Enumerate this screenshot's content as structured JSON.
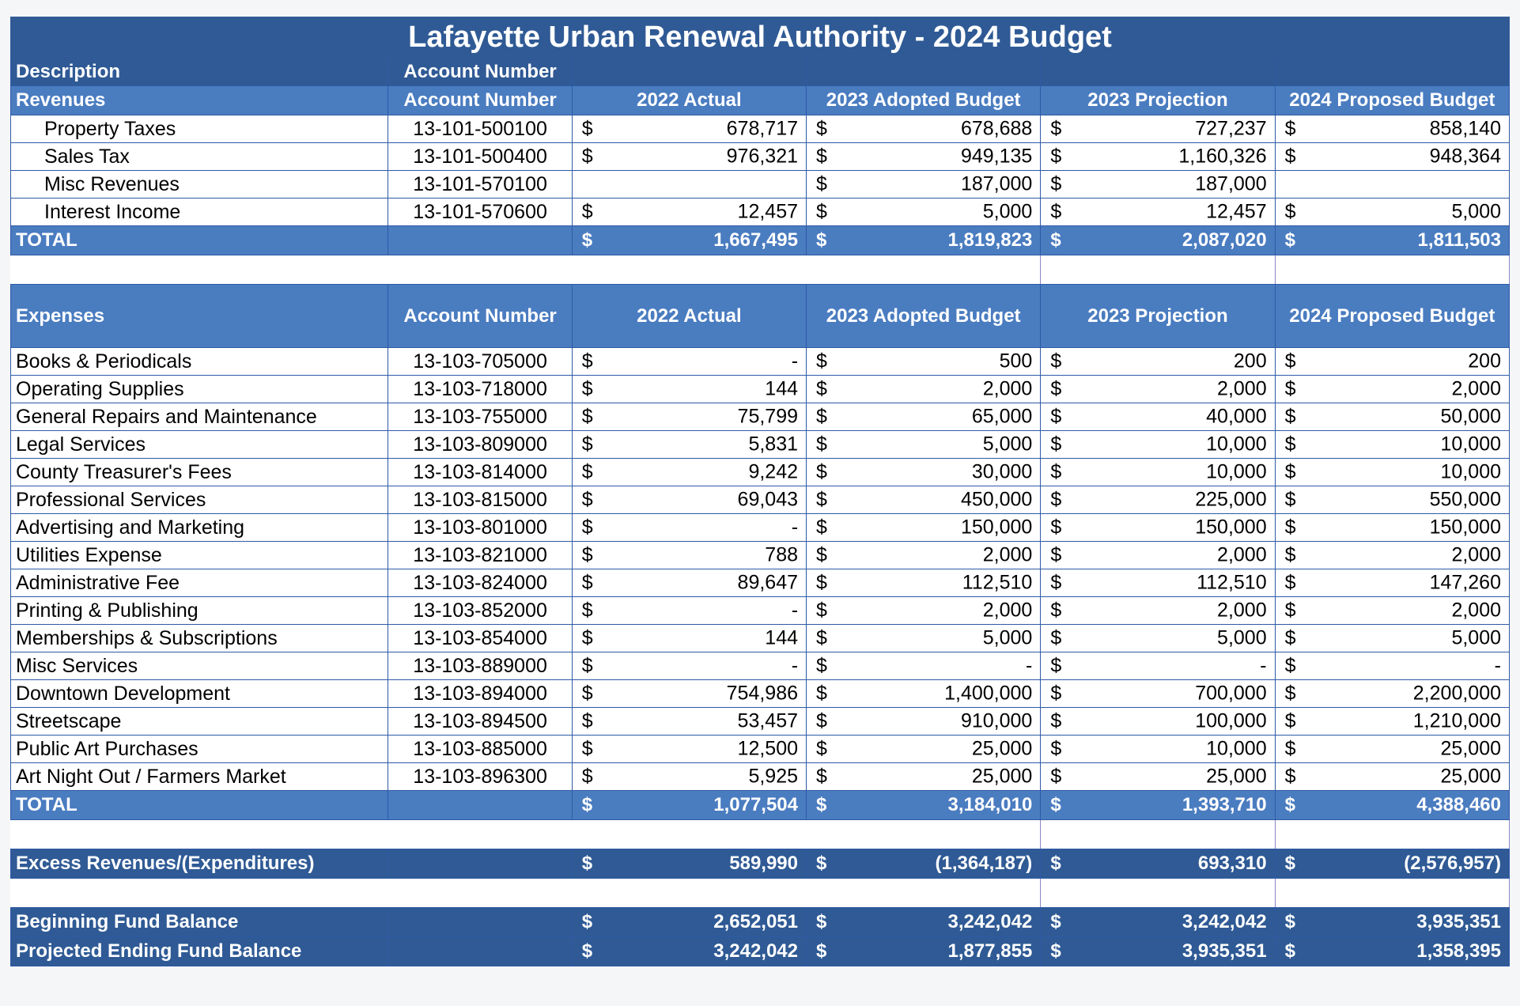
{
  "title": "Lafayette Urban Renewal Authority - 2024 Budget",
  "desc_row": {
    "description": "Description",
    "account_number": "Account Number"
  },
  "revenues": {
    "header": [
      "Revenues",
      "Account Number",
      "2022 Actual",
      "2023 Adopted Budget",
      "2023 Projection",
      "2024 Proposed Budget"
    ],
    "rows": [
      {
        "label": "Property Taxes",
        "account": "13-101-500100",
        "v": [
          [
            "$",
            "678,717"
          ],
          [
            "$",
            "678,688"
          ],
          [
            "$",
            "727,237"
          ],
          [
            "$",
            "858,140"
          ]
        ]
      },
      {
        "label": "Sales Tax",
        "account": "13-101-500400",
        "v": [
          [
            "$",
            "976,321"
          ],
          [
            "$",
            "949,135"
          ],
          [
            "$",
            "1,160,326"
          ],
          [
            "$",
            "948,364"
          ]
        ]
      },
      {
        "label": "Misc Revenues",
        "account": "13-101-570100",
        "v": [
          [
            "",
            ""
          ],
          [
            "$",
            "187,000"
          ],
          [
            "$",
            "187,000"
          ],
          [
            "",
            ""
          ]
        ]
      },
      {
        "label": "Interest Income",
        "account": "13-101-570600",
        "v": [
          [
            "$",
            "12,457"
          ],
          [
            "$",
            "5,000"
          ],
          [
            "$",
            "12,457"
          ],
          [
            "$",
            "5,000"
          ]
        ]
      }
    ],
    "total": {
      "label": "TOTAL",
      "v": [
        [
          "$",
          "1,667,495"
        ],
        [
          "$",
          "1,819,823"
        ],
        [
          "$",
          "2,087,020"
        ],
        [
          "$",
          "1,811,503"
        ]
      ]
    }
  },
  "expenses": {
    "header": [
      "Expenses",
      "Account Number",
      "2022 Actual",
      "2023 Adopted Budget",
      "2023 Projection",
      "2024 Proposed Budget"
    ],
    "rows": [
      {
        "label": "Books & Periodicals",
        "account": "13-103-705000",
        "v": [
          [
            "$",
            "-"
          ],
          [
            "$",
            "500"
          ],
          [
            "$",
            "200"
          ],
          [
            "$",
            "200"
          ]
        ]
      },
      {
        "label": "Operating Supplies",
        "account": "13-103-718000",
        "v": [
          [
            "$",
            "144"
          ],
          [
            "$",
            "2,000"
          ],
          [
            "$",
            "2,000"
          ],
          [
            "$",
            "2,000"
          ]
        ]
      },
      {
        "label": "General Repairs and Maintenance",
        "account": "13-103-755000",
        "v": [
          [
            "$",
            "75,799"
          ],
          [
            "$",
            "65,000"
          ],
          [
            "$",
            "40,000"
          ],
          [
            "$",
            "50,000"
          ]
        ]
      },
      {
        "label": "Legal Services",
        "account": "13-103-809000",
        "v": [
          [
            "$",
            "5,831"
          ],
          [
            "$",
            "5,000"
          ],
          [
            "$",
            "10,000"
          ],
          [
            "$",
            "10,000"
          ]
        ]
      },
      {
        "label": "County Treasurer's Fees",
        "account": "13-103-814000",
        "v": [
          [
            "$",
            "9,242"
          ],
          [
            "$",
            "30,000"
          ],
          [
            "$",
            "10,000"
          ],
          [
            "$",
            "10,000"
          ]
        ]
      },
      {
        "label": "Professional Services",
        "account": "13-103-815000",
        "v": [
          [
            "$",
            "69,043"
          ],
          [
            "$",
            "450,000"
          ],
          [
            "$",
            "225,000"
          ],
          [
            "$",
            "550,000"
          ]
        ]
      },
      {
        "label": "Advertising and Marketing",
        "account": "13-103-801000",
        "v": [
          [
            "$",
            "-"
          ],
          [
            "$",
            "150,000"
          ],
          [
            "$",
            "150,000"
          ],
          [
            "$",
            "150,000"
          ]
        ]
      },
      {
        "label": "Utilities Expense",
        "account": "13-103-821000",
        "v": [
          [
            "$",
            "788"
          ],
          [
            "$",
            "2,000"
          ],
          [
            "$",
            "2,000"
          ],
          [
            "$",
            "2,000"
          ]
        ]
      },
      {
        "label": "Administrative Fee",
        "account": "13-103-824000",
        "v": [
          [
            "$",
            "89,647"
          ],
          [
            "$",
            "112,510"
          ],
          [
            "$",
            "112,510"
          ],
          [
            "$",
            "147,260"
          ]
        ]
      },
      {
        "label": "Printing & Publishing",
        "account": "13-103-852000",
        "v": [
          [
            "$",
            "-"
          ],
          [
            "$",
            "2,000"
          ],
          [
            "$",
            "2,000"
          ],
          [
            "$",
            "2,000"
          ]
        ]
      },
      {
        "label": "Memberships & Subscriptions",
        "account": "13-103-854000",
        "v": [
          [
            "$",
            "144"
          ],
          [
            "$",
            "5,000"
          ],
          [
            "$",
            "5,000"
          ],
          [
            "$",
            "5,000"
          ]
        ]
      },
      {
        "label": "Misc Services",
        "account": "13-103-889000",
        "v": [
          [
            "$",
            "-"
          ],
          [
            "$",
            "-"
          ],
          [
            "$",
            "-"
          ],
          [
            "$",
            "-"
          ]
        ]
      },
      {
        "label": "Downtown Development",
        "account": "13-103-894000",
        "v": [
          [
            "$",
            "754,986"
          ],
          [
            "$",
            "1,400,000"
          ],
          [
            "$",
            "700,000"
          ],
          [
            "$",
            "2,200,000"
          ]
        ]
      },
      {
        "label": "Streetscape",
        "account": "13-103-894500",
        "v": [
          [
            "$",
            "53,457"
          ],
          [
            "$",
            "910,000"
          ],
          [
            "$",
            "100,000"
          ],
          [
            "$",
            "1,210,000"
          ]
        ]
      },
      {
        "label": "Public Art Purchases",
        "account": "13-103-885000",
        "v": [
          [
            "$",
            "12,500"
          ],
          [
            "$",
            "25,000"
          ],
          [
            "$",
            "10,000"
          ],
          [
            "$",
            "25,000"
          ]
        ]
      },
      {
        "label": "Art Night Out / Farmers Market",
        "account": "13-103-896300",
        "v": [
          [
            "$",
            "5,925"
          ],
          [
            "$",
            "25,000"
          ],
          [
            "$",
            "25,000"
          ],
          [
            "$",
            "25,000"
          ]
        ]
      }
    ],
    "total": {
      "label": "TOTAL",
      "v": [
        [
          "$",
          "1,077,504"
        ],
        [
          "$",
          "3,184,010"
        ],
        [
          "$",
          "1,393,710"
        ],
        [
          "$",
          "4,388,460"
        ]
      ]
    }
  },
  "excess": {
    "label": "Excess Revenues/(Expenditures)",
    "v": [
      [
        "$",
        "589,990"
      ],
      [
        "$",
        "(1,364,187)"
      ],
      [
        "$",
        "693,310"
      ],
      [
        "$",
        "(2,576,957)"
      ]
    ]
  },
  "beginning": {
    "label": "Beginning Fund Balance",
    "v": [
      [
        "$",
        "2,652,051"
      ],
      [
        "$",
        "3,242,042"
      ],
      [
        "$",
        "3,242,042"
      ],
      [
        "$",
        "3,935,351"
      ]
    ]
  },
  "ending": {
    "label": "Projected Ending Fund Balance",
    "v": [
      [
        "$",
        "3,242,042"
      ],
      [
        "$",
        "1,877,855"
      ],
      [
        "$",
        "3,935,351"
      ],
      [
        "$",
        "1,358,395"
      ]
    ]
  },
  "colors": {
    "dark_header": "#2f5a95",
    "light_header": "#4a7cc0",
    "grid": "#2e5aa6"
  }
}
